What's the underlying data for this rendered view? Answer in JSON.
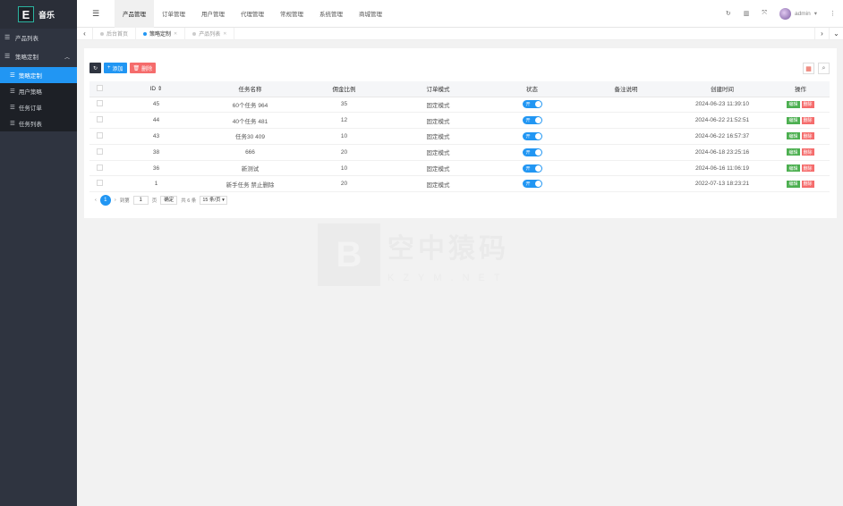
{
  "app": {
    "logo_letter": "E",
    "name": "音乐"
  },
  "sidebar": {
    "items": [
      {
        "label": "产品列表"
      },
      {
        "label": "策略定制"
      }
    ],
    "sub_items": [
      {
        "label": "策略定制"
      },
      {
        "label": "用户策略"
      },
      {
        "label": "任务订单"
      },
      {
        "label": "任务列表"
      }
    ]
  },
  "topnav": [
    {
      "label": "产品管理"
    },
    {
      "label": "订单管理"
    },
    {
      "label": "用户管理"
    },
    {
      "label": "代理管理"
    },
    {
      "label": "常规管理"
    },
    {
      "label": "系统管理"
    },
    {
      "label": "商城管理"
    }
  ],
  "user": {
    "name": "admin"
  },
  "tabs": [
    {
      "label": "后台首页"
    },
    {
      "label": "策略定制"
    },
    {
      "label": "产品列表"
    }
  ],
  "toolbar": {
    "add_label": "添加",
    "delete_label": "删除"
  },
  "table": {
    "headers": {
      "id": "ID",
      "name": "任务名称",
      "ratio": "佣金比例",
      "mode": "订单模式",
      "status": "状态",
      "note": "备注说明",
      "time": "创建时间",
      "ops": "操作"
    },
    "rows": [
      {
        "id": "45",
        "name": "60个任务 964",
        "ratio": "35",
        "mode": "固定模式",
        "status": "开",
        "note": "",
        "time": "2024-06-23 11:39:10"
      },
      {
        "id": "44",
        "name": "40个任务 481",
        "ratio": "12",
        "mode": "固定模式",
        "status": "开",
        "note": "",
        "time": "2024-06-22 21:52:51"
      },
      {
        "id": "43",
        "name": "任务30 409",
        "ratio": "10",
        "mode": "固定模式",
        "status": "开",
        "note": "",
        "time": "2024-06-22 16:57:37"
      },
      {
        "id": "38",
        "name": "666",
        "ratio": "20",
        "mode": "固定模式",
        "status": "开",
        "note": "",
        "time": "2024-06-18 23:25:16"
      },
      {
        "id": "36",
        "name": "新测试",
        "ratio": "10",
        "mode": "固定模式",
        "status": "开",
        "note": "",
        "time": "2024-06-16 11:06:19"
      },
      {
        "id": "1",
        "name": "新手任务 禁止删除",
        "ratio": "20",
        "mode": "固定模式",
        "status": "开",
        "note": "",
        "time": "2022-07-13 18:23:21"
      }
    ],
    "edit_label": "编辑",
    "delete_label": "删除"
  },
  "pager": {
    "current": "1",
    "goto_label": "到第",
    "page_input": "1",
    "page_unit": "页",
    "confirm_label": "确定",
    "total_label": "共 6 条",
    "per_page": "15 条/页"
  },
  "watermark": {
    "big": "空中猿码",
    "small": "KZYM.NET"
  }
}
